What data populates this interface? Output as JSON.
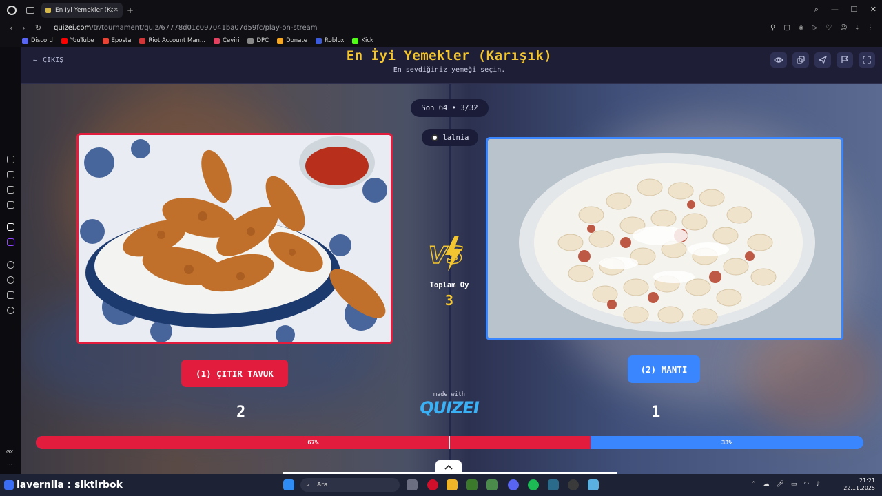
{
  "browser": {
    "tab_title": "En İyi Yemekler (Karışık)",
    "tab_close": "✕",
    "new_tab": "+",
    "url_domain": "quizei.com",
    "url_path": "/tr/tournament/quiz/67778d01c097041ba07d59fc/play-on-stream",
    "bookmarks": [
      {
        "label": "Discord",
        "color": "#5865f2"
      },
      {
        "label": "YouTube",
        "color": "#ff0000"
      },
      {
        "label": "Eposta",
        "color": "#ea4335"
      },
      {
        "label": "Riot Account Man...",
        "color": "#d13639"
      },
      {
        "label": "Çeviri",
        "color": "#e4405f"
      },
      {
        "label": "DPC",
        "color": "#888888"
      },
      {
        "label": "Donate",
        "color": "#f5a623"
      },
      {
        "label": "Roblox",
        "color": "#3b5bdb"
      },
      {
        "label": "Kick",
        "color": "#53fc18"
      }
    ],
    "sidebar_gx": "GX",
    "sidebar_more": "···"
  },
  "header": {
    "exit_label": "ÇIKIŞ",
    "title": "En İyi Yemekler (Karışık)",
    "subtitle": "En sevdiğiniz yemeği seçin.",
    "buttons": [
      "eye-icon",
      "copy-icon",
      "send-icon",
      "flag-icon",
      "fullscreen-icon"
    ]
  },
  "round": {
    "label": "Son 64 • 3/32",
    "streamer": "lalnia"
  },
  "matchup": {
    "left": {
      "label": "(1) ÇITIR TAVUK",
      "votes": "2",
      "percent_label": "67%",
      "percent": 67,
      "color": "#e21c3d"
    },
    "right": {
      "label": "(2) MANTI",
      "votes": "1",
      "percent_label": "33%",
      "percent": 33,
      "color": "#3a86ff"
    },
    "total_label": "Toplam Oy",
    "total_value": "3"
  },
  "branding": {
    "made_with": "made with",
    "logo": "QUIZEI"
  },
  "taskbar": {
    "stream_text": "lavernlia : siktirbok",
    "search_placeholder": "Ara",
    "time": "21:21",
    "date": "22.11.2025"
  }
}
